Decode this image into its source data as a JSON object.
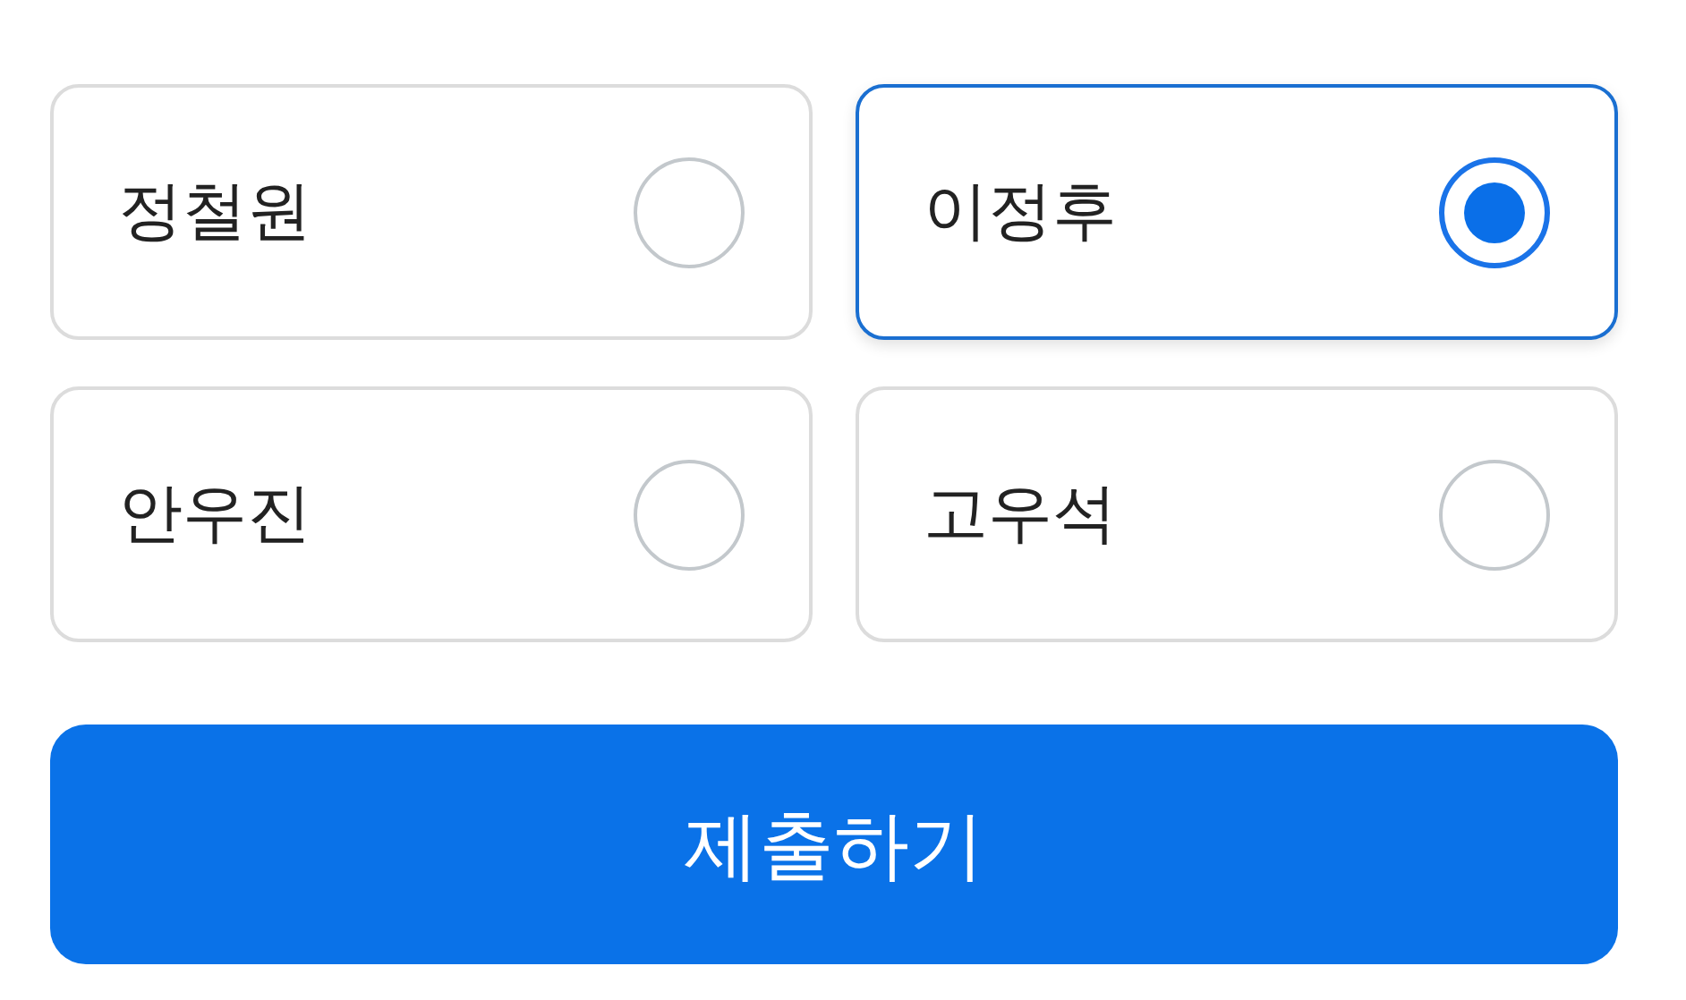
{
  "options": [
    {
      "label": "정철원",
      "selected": false
    },
    {
      "label": "이정후",
      "selected": true
    },
    {
      "label": "안우진",
      "selected": false
    },
    {
      "label": "고우석",
      "selected": false
    }
  ],
  "submit_button": "제출하기"
}
